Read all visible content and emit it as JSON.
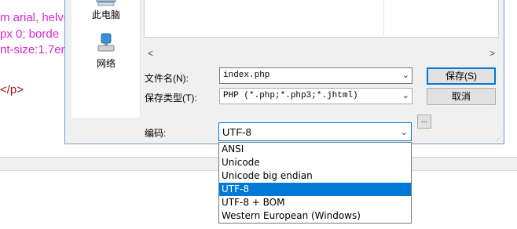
{
  "editor": {
    "lines": [
      "m arial, helve",
      "px 0; borde",
      "nt-size:1.7er",
      "</p>"
    ]
  },
  "dialog": {
    "places": [
      {
        "label": "此电脑",
        "icon": "computer-icon"
      },
      {
        "label": "网络",
        "icon": "network-icon"
      }
    ],
    "scroll_left": "<",
    "scroll_right": ">",
    "filename_label": "文件名(N):",
    "filename_value": "index.php",
    "filetype_label": "保存类型(T):",
    "filetype_value": "PHP (*.php;*.php3;*.jhtml)",
    "save_button": "保存(S)",
    "cancel_button": "取消",
    "encoding_label": "编码:",
    "encoding_value": "UTF-8",
    "more_button": "...",
    "encoding_options": [
      "ANSI",
      "Unicode",
      "Unicode big endian",
      "UTF-8",
      "UTF-8 + BOM",
      "Western European (Windows)"
    ],
    "selected_option": "UTF-8",
    "accent_color": "#0078d7"
  }
}
